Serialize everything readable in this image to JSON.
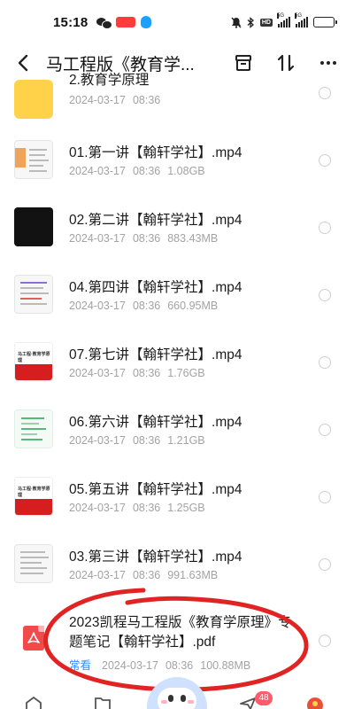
{
  "status_bar": {
    "time": "15:18",
    "icons": [
      "wechat-icon",
      "red-app-badge-icon",
      "qq-icon",
      "mute-bell-icon",
      "bluetooth-icon",
      "hd-icon",
      "signal-5g-icon",
      "signal-5g-2-icon",
      "battery-icon"
    ]
  },
  "header": {
    "title": "马工程版《教育学...",
    "actions": [
      "archive-icon",
      "sort-icon",
      "more-icon"
    ]
  },
  "files": [
    {
      "name": "2.教育学原理",
      "date": "2024-03-17",
      "time": "08:36",
      "size": "",
      "thumb": "folder"
    },
    {
      "name": "01.第一讲【翰轩学社】.mp4",
      "date": "2024-03-17",
      "time": "08:36",
      "size": "1.08GB",
      "thumb": "doc-orange"
    },
    {
      "name": "02.第二讲【翰轩学社】.mp4",
      "date": "2024-03-17",
      "time": "08:36",
      "size": "883.43MB",
      "thumb": "dark"
    },
    {
      "name": "04.第四讲【翰轩学社】.mp4",
      "date": "2024-03-17",
      "time": "08:36",
      "size": "660.95MB",
      "thumb": "doc"
    },
    {
      "name": "07.第七讲【翰轩学社】.mp4",
      "date": "2024-03-17",
      "time": "08:36",
      "size": "1.76GB",
      "thumb": "red"
    },
    {
      "name": "06.第六讲【翰轩学社】.mp4",
      "date": "2024-03-17",
      "time": "08:36",
      "size": "1.21GB",
      "thumb": "green"
    },
    {
      "name": "05.第五讲【翰轩学社】.mp4",
      "date": "2024-03-17",
      "time": "08:36",
      "size": "1.25GB",
      "thumb": "red"
    },
    {
      "name": "03.第三讲【翰轩学社】.mp4",
      "date": "2024-03-17",
      "time": "08:36",
      "size": "991.63MB",
      "thumb": "doc"
    }
  ],
  "pdf_file": {
    "name_line1": "2023凯程马工程版《教育学原理》专",
    "name_line2": "题笔记【翰轩学社】.pdf",
    "tag": "常看",
    "date": "2024-03-17",
    "time": "08:36",
    "size": "100.88MB"
  },
  "thumb_text": {
    "red_cover": "马工程·教育学原理"
  },
  "bottom_nav": {
    "badge": "48",
    "items": [
      "home-icon",
      "files-icon",
      "assistant-mascot",
      "share-icon",
      "profile-icon"
    ]
  },
  "colors": {
    "annotation": "#e02424",
    "pdf": "#f24a4a",
    "folder": "#ffd24a",
    "tag": "#3b8cff"
  }
}
